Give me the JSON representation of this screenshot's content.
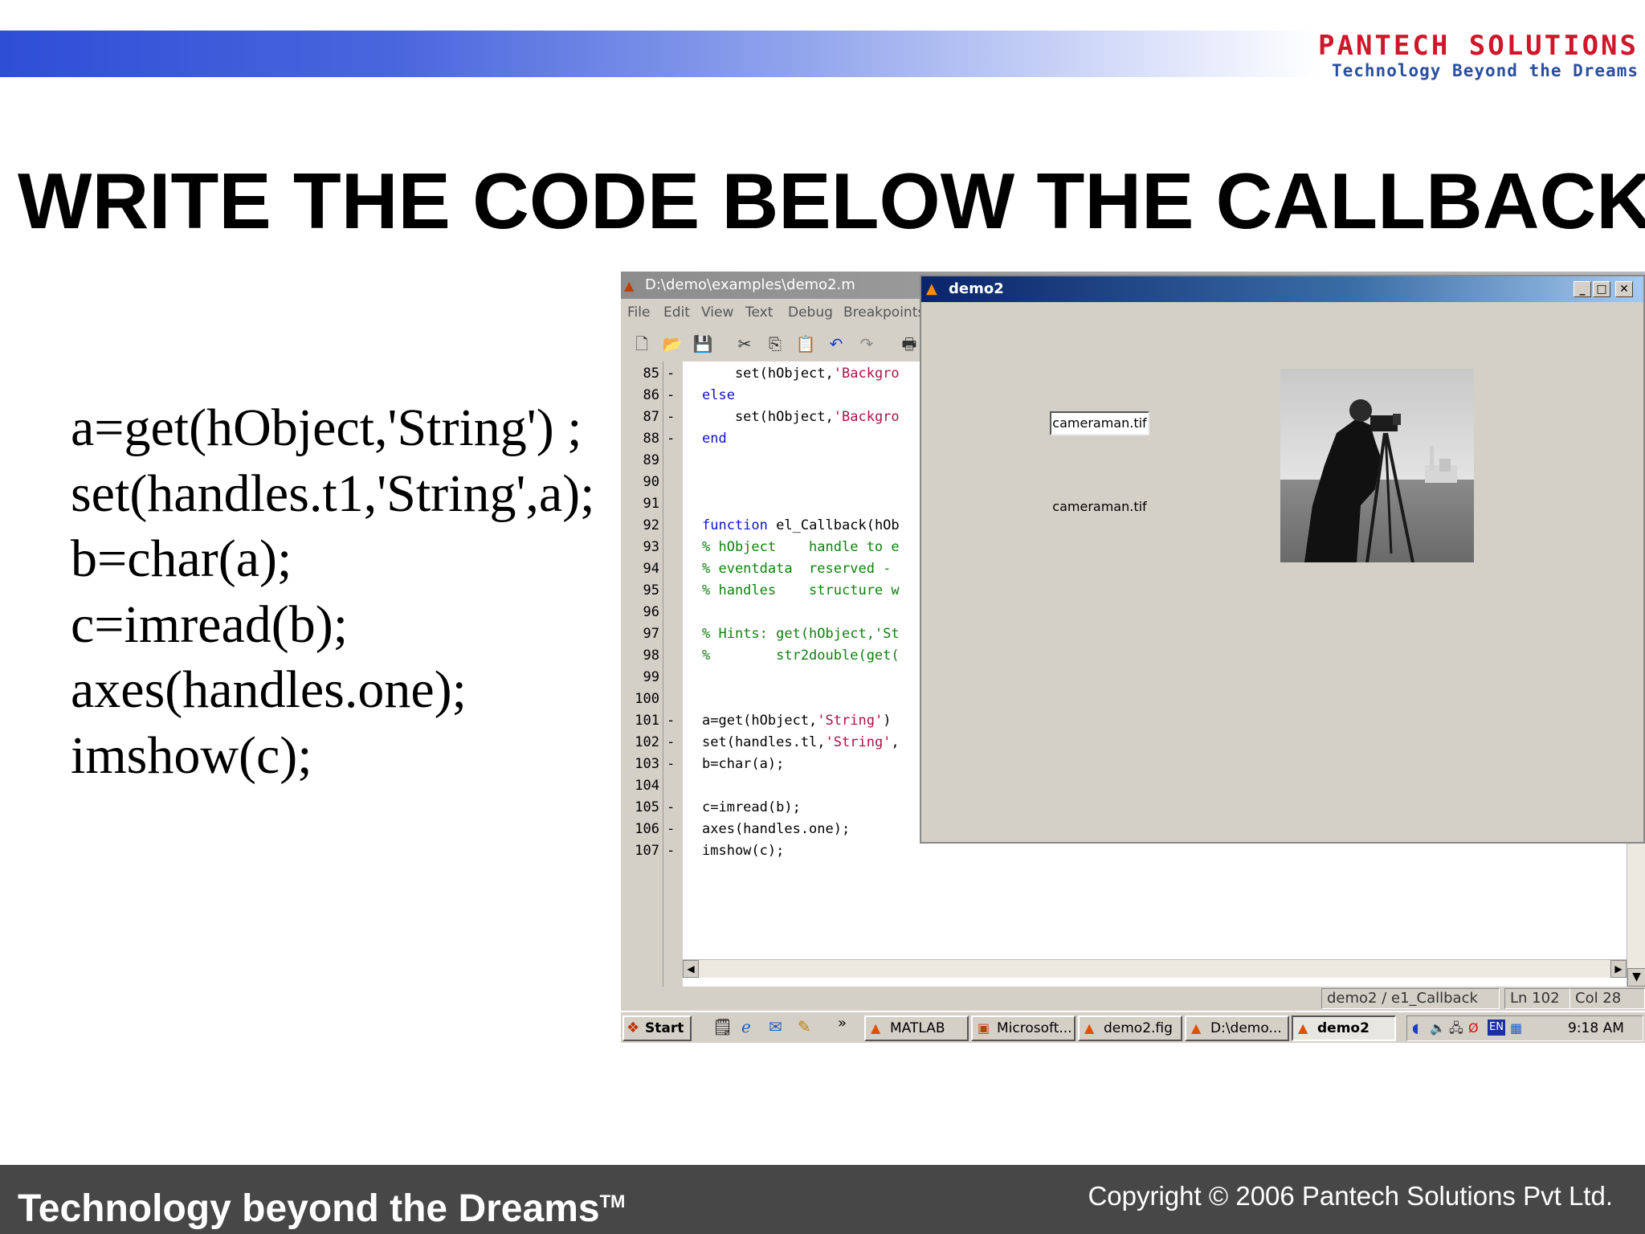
{
  "header": {
    "logo_name": "PANTECH SOLUTIONS",
    "logo_tagline": "Technology Beyond the Dreams"
  },
  "slide": {
    "title": "WRITE THE CODE BELOW THE CALLBACK",
    "code_lines": [
      "a=get(hObject,'String') ;",
      "set(handles.t1,'String',a);",
      "b=char(a);",
      "c=imread(b);",
      "axes(handles.one);",
      "imshow(c);"
    ]
  },
  "editor": {
    "title": "D:\\demo\\examples\\demo2.m",
    "menu": [
      "File",
      "Edit",
      "View",
      "Text",
      "Debug",
      "Breakpoints"
    ],
    "lines": [
      {
        "num": "85",
        "mark": "-",
        "parts": [
          {
            "t": "    set(hObject,",
            "c": "pl"
          },
          {
            "t": "'Backgro",
            "c": "str"
          }
        ]
      },
      {
        "num": "86",
        "mark": "-",
        "parts": [
          {
            "t": "else",
            "c": "kw"
          }
        ]
      },
      {
        "num": "87",
        "mark": "-",
        "parts": [
          {
            "t": "    set(hObject,",
            "c": "pl"
          },
          {
            "t": "'Backgro",
            "c": "str"
          }
        ]
      },
      {
        "num": "88",
        "mark": "-",
        "parts": [
          {
            "t": "end",
            "c": "kw"
          }
        ]
      },
      {
        "num": "89",
        "mark": "",
        "parts": []
      },
      {
        "num": "90",
        "mark": "",
        "parts": []
      },
      {
        "num": "91",
        "mark": "",
        "parts": []
      },
      {
        "num": "92",
        "mark": "",
        "parts": [
          {
            "t": "function",
            "c": "kw"
          },
          {
            "t": " el_Callback(hOb",
            "c": "pl"
          }
        ]
      },
      {
        "num": "93",
        "mark": "",
        "parts": [
          {
            "t": "% hObject    handle to e",
            "c": "cm"
          }
        ]
      },
      {
        "num": "94",
        "mark": "",
        "parts": [
          {
            "t": "% eventdata  reserved -",
            "c": "cm"
          }
        ]
      },
      {
        "num": "95",
        "mark": "",
        "parts": [
          {
            "t": "% handles    structure w",
            "c": "cm"
          }
        ]
      },
      {
        "num": "96",
        "mark": "",
        "parts": []
      },
      {
        "num": "97",
        "mark": "",
        "parts": [
          {
            "t": "% Hints: get(hObject,'St",
            "c": "cm"
          }
        ]
      },
      {
        "num": "98",
        "mark": "",
        "parts": [
          {
            "t": "%        str2double(get(",
            "c": "cm"
          }
        ]
      },
      {
        "num": "99",
        "mark": "",
        "parts": []
      },
      {
        "num": "100",
        "mark": "",
        "parts": []
      },
      {
        "num": "101",
        "mark": "-",
        "parts": [
          {
            "t": "a=get(hObject,",
            "c": "pl"
          },
          {
            "t": "'String'",
            "c": "str"
          },
          {
            "t": ")",
            "c": "pl"
          }
        ]
      },
      {
        "num": "102",
        "mark": "-",
        "parts": [
          {
            "t": "set(handles.tl,",
            "c": "pl"
          },
          {
            "t": "'String'",
            "c": "str"
          },
          {
            "t": ",",
            "c": "pl"
          }
        ]
      },
      {
        "num": "103",
        "mark": "-",
        "parts": [
          {
            "t": "b=char(a);",
            "c": "pl"
          }
        ]
      },
      {
        "num": "104",
        "mark": "",
        "parts": []
      },
      {
        "num": "105",
        "mark": "-",
        "parts": [
          {
            "t": "c=imread(b);",
            "c": "pl"
          }
        ]
      },
      {
        "num": "106",
        "mark": "-",
        "parts": [
          {
            "t": "axes(handles.one);",
            "c": "pl"
          }
        ]
      },
      {
        "num": "107",
        "mark": "-",
        "parts": [
          {
            "t": "imshow(c);",
            "c": "pl"
          }
        ]
      }
    ],
    "status": {
      "function": "demo2 / e1_Callback",
      "line": "Ln 102",
      "col": "Col 28"
    }
  },
  "taskbar": {
    "start": "Start",
    "chevron": "»",
    "tasks": [
      "MATLAB",
      "Microsoft...",
      "demo2.fig",
      "D:\\demo...",
      "demo2"
    ],
    "tray_lang": "EN",
    "clock": "9:18 AM"
  },
  "figure_window": {
    "title": "demo2",
    "edit_value": "cameraman.tif",
    "static_text": "cameraman.tif"
  },
  "footer": {
    "tagline": "Technology beyond the Dreams",
    "tm": "TM",
    "copyright": "Copyright © 2006 Pantech Solutions Pvt Ltd."
  },
  "colors": {
    "keyword": "#1010d0",
    "string": "#b0104a",
    "comment": "#108010",
    "footer_bg": "#474747",
    "logo_red": "#d0162a",
    "logo_blue": "#2a4fa0"
  }
}
